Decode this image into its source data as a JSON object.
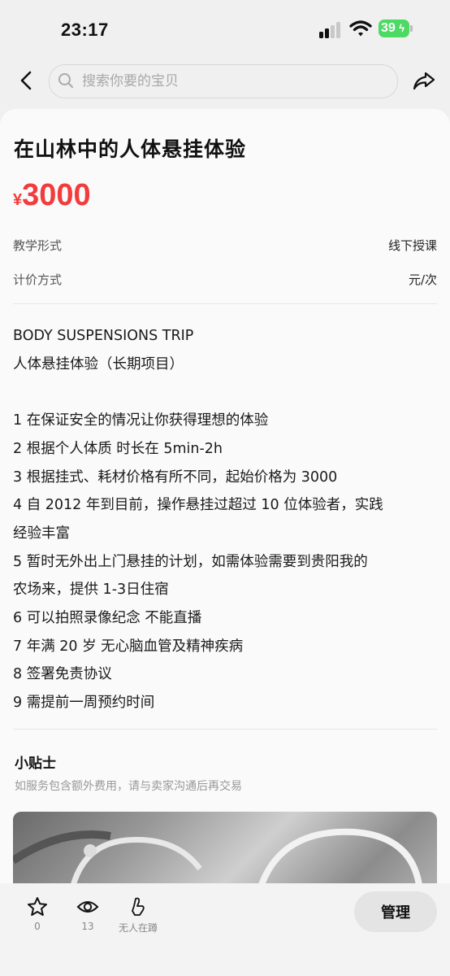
{
  "status_bar": {
    "time": "23:17",
    "battery": "39"
  },
  "search": {
    "placeholder": "搜索你要的宝贝"
  },
  "item": {
    "title": "在山林中的人体悬挂体验",
    "currency": "¥",
    "price": "3000",
    "attributes": [
      {
        "label": "教学形式",
        "value": "线下授课"
      },
      {
        "label": "计价方式",
        "value": "元/次"
      }
    ],
    "description": [
      "BODY SUSPENSIONS TRIP",
      "人体悬挂体验（长期项目）",
      "",
      "1 在保证安全的情况让你获得理想的体验",
      "2 根据个人体质 时长在 5min-2h",
      "3 根据挂式、耗材价格有所不同，起始价格为 3000",
      "4 自 2012 年到目前，操作悬挂过超过 10 位体验者，实践",
      "经验丰富",
      "5 暂时无外出上门悬挂的计划，如需体验需要到贵阳我的",
      "农场来，提供 1-3日住宿",
      "6 可以拍照录像纪念 不能直播",
      "7 年满 20 岁 无心脑血管及精神疾病",
      "8 签署免责协议",
      "9 需提前一周预约时间"
    ]
  },
  "tips": {
    "title": "小贴士",
    "text": "如服务包含额外费用，请与卖家沟通后再交易"
  },
  "bottom_bar": {
    "favorites": "0",
    "views": "13",
    "want_label": "无人在蹲",
    "manage_label": "管理"
  }
}
